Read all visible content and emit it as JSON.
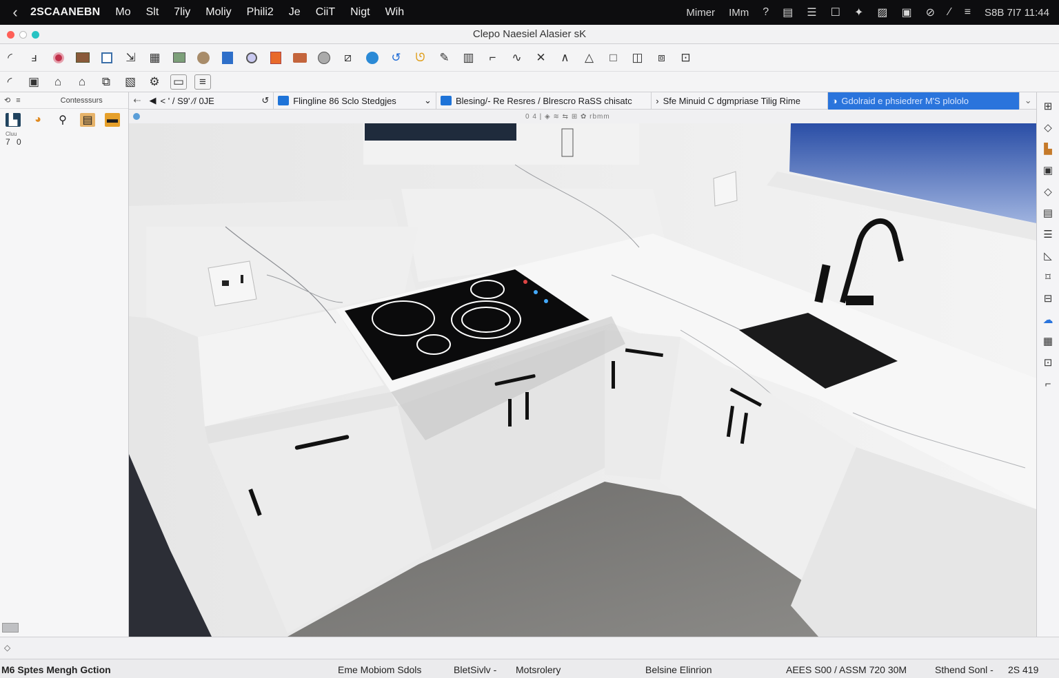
{
  "menubar": {
    "app_name": "2SCAANEBN",
    "items": [
      "Mo",
      "Slt",
      "7liy",
      "Moliy",
      "Phili2",
      "Je",
      "CiiT",
      "Nigt",
      "Wih"
    ],
    "right_items": [
      "Mimer",
      "IMm"
    ],
    "clock": "S8B 7I7 11:44"
  },
  "window": {
    "title": "Clepo Naesiel Alasier sK"
  },
  "sidebar": {
    "header_label": "Contesssurs",
    "tiny_label": "Cluu",
    "number_readout": "7 0"
  },
  "docbar": {
    "path_label": "< ' / S9' ∕/ 0JE",
    "tabs": [
      {
        "label": "Flingline 86 Sclo Stedgjes"
      },
      {
        "label": "Blesing/- Re Resres / Blrescro RaSS chisatc"
      },
      {
        "label": "Sfe Minuid C dgmpriase Tilig Rime"
      },
      {
        "label": "Gdolraid e phsiedrer M'S plololo"
      }
    ]
  },
  "subbar": {
    "center_text": "0 4 | ◈ ≋ ⇆ ⊞ ✿ rbmm"
  },
  "statusbar": {
    "left": "M6 Sptes Mengh Gction",
    "mode": "Eme Mobiom Sdols",
    "unit": "BletSivlv -",
    "style": "Motsrolery",
    "tag": "Belsine Elinrion",
    "coords": "AEES S00 / ASSM 720 30M",
    "status": "Sthend Sonl -",
    "zoom": "2S 419"
  },
  "colors": {
    "accent": "#2a74dc",
    "menubar_bg": "#0d0d0f",
    "close": "#ff5f57",
    "minimize": "#d0d0d0",
    "maximize": "#27c3c3"
  },
  "toolbar_icons_row1": [
    "select-arrow",
    "paint",
    "record",
    "texture",
    "window",
    "export",
    "layer",
    "image",
    "globe",
    "bucket",
    "orbit",
    "book",
    "stack",
    "sphere",
    "tape",
    "earth",
    "rotate",
    "lasso",
    "pen",
    "grid",
    "line",
    "freehand",
    "cross",
    "angle",
    "triangle",
    "square",
    "rect-split",
    "rect",
    "rect-small"
  ],
  "toolbar_icons_row2": [
    "pan",
    "save",
    "house",
    "house-color",
    "component",
    "landscape",
    "settings",
    "message",
    "note"
  ]
}
